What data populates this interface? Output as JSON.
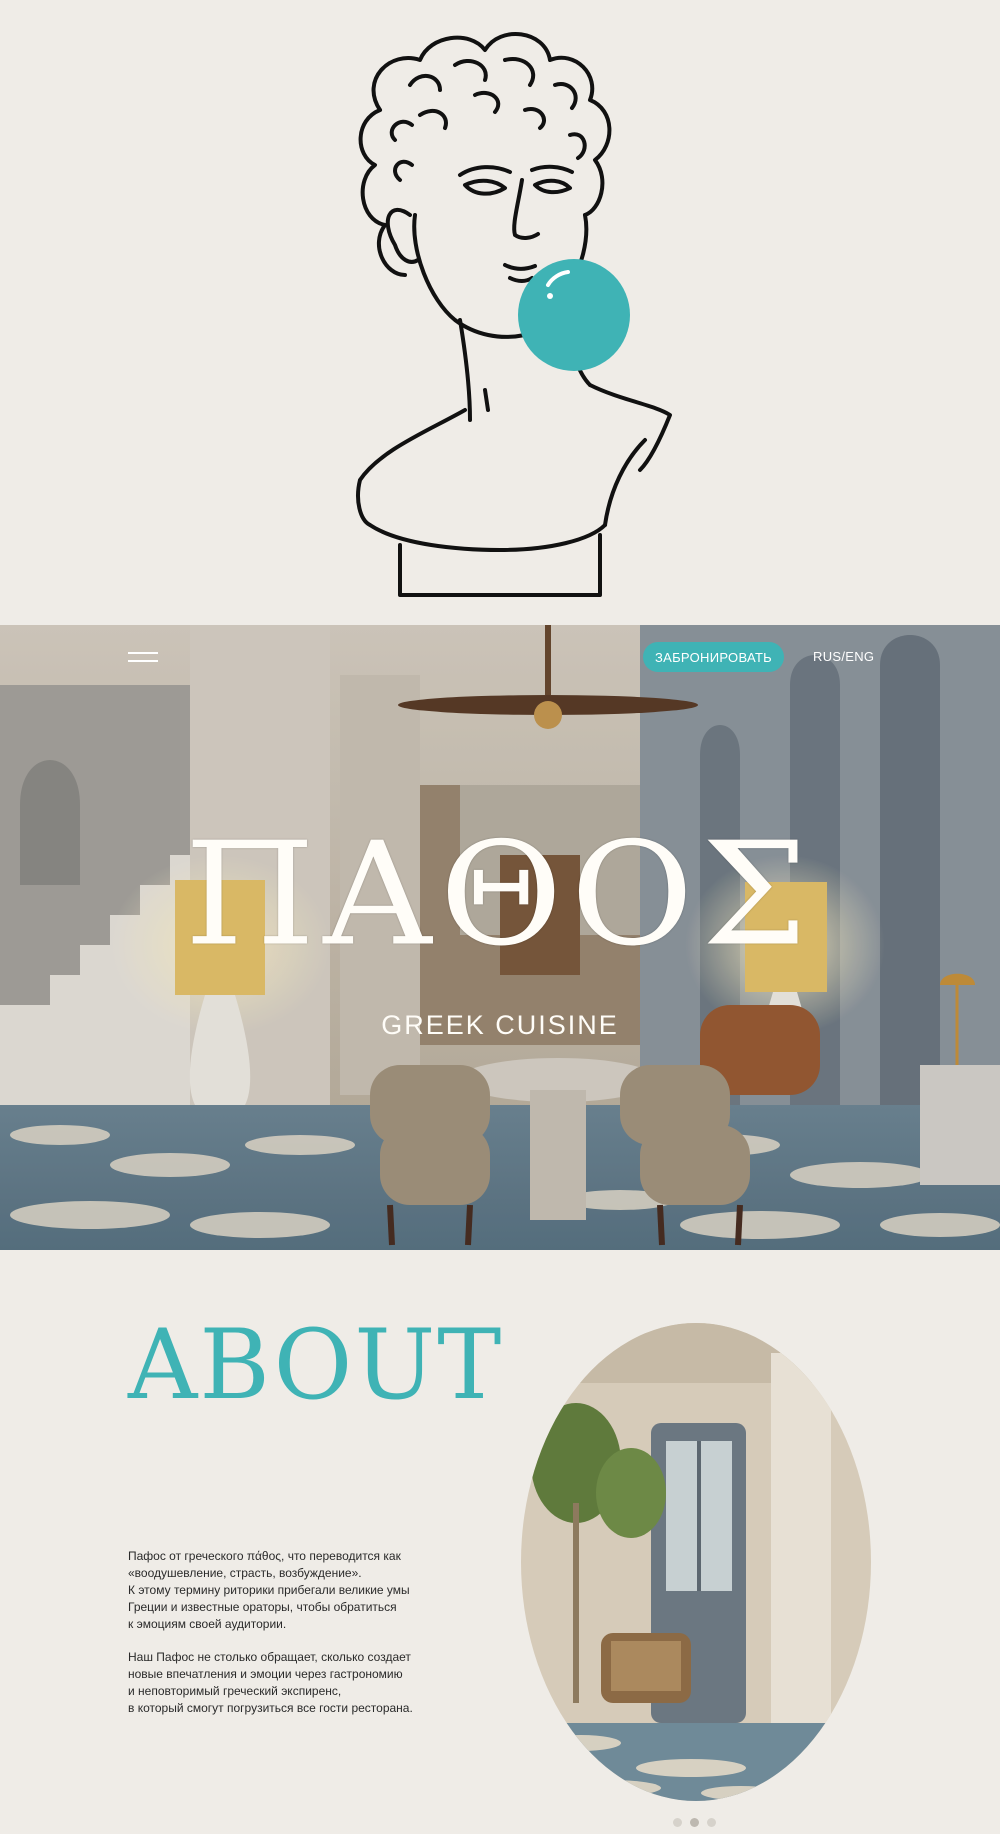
{
  "colors": {
    "accent": "#3fb3b5",
    "background": "#efece7",
    "text": "#2a2a2a"
  },
  "intro": {
    "illustration": "david-bust-bubblegum-icon"
  },
  "header": {
    "menu_icon": "hamburger-menu-icon",
    "book_label": "ЗАБРОНИРОВАТЬ",
    "lang_label": "RUS/ENG"
  },
  "hero": {
    "logo": "ΠΑΘΟΣ",
    "subtitle": "GREEK CUISINE"
  },
  "about": {
    "title": "ABOUT",
    "paragraph_1": "Пафос от греческого πάθος, что переводится как\n«воодушевление, страсть, возбуждение».\nК этому термину риторики прибегали великие умы\nГреции и известные ораторы, чтобы обратиться\nк эмоциям своей аудитории.",
    "paragraph_2": "Наш Пафос не столько обращает, сколько создает\nновые впечатления и эмоции через гастрономию\nи неповторимый греческий экспиренс,\nв который смогут погрузиться все гости ресторана.",
    "slider_count": 3,
    "slider_active": 2
  }
}
